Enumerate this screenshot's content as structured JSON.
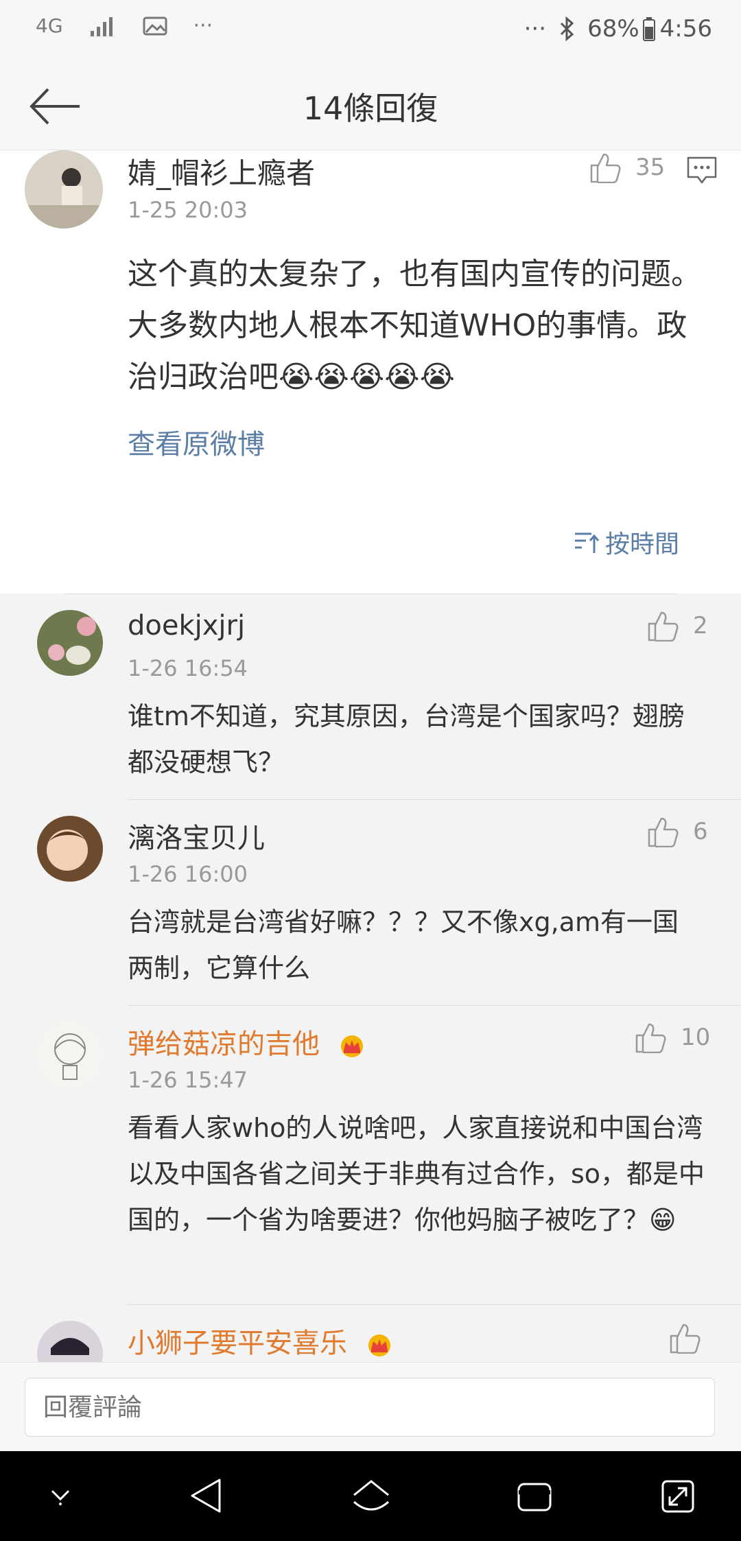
{
  "status_bar": {
    "network": "4G",
    "more_left": "···",
    "more_right": "···",
    "battery": "68%",
    "time": "4:56"
  },
  "header": {
    "title": "14條回復"
  },
  "main_comment": {
    "name": "婧_帽衫上瘾者",
    "time": "1-25 20:03",
    "likes": "35",
    "text": "这个真的太复杂了，也有国内宣传的问题。大多数内地人根本不知道WHO的事情。政治归政治吧😭😭😭😭😭",
    "view_original": "查看原微博"
  },
  "sort_label": "按時間",
  "replies": [
    {
      "name": "doekjxjrj",
      "time": "1-26 16:54",
      "likes": "2",
      "text": "谁tm不知道，究其原因，台湾是个国家吗？翅膀都没硬想飞？"
    },
    {
      "name": "漓洛宝贝儿",
      "time": "1-26 16:00",
      "likes": "6",
      "text": "台湾就是台湾省好嘛？？？又不像xg,am有一国两制，它算什么"
    },
    {
      "name": "弹给菇凉的吉他",
      "time": "1-26 15:47",
      "likes": "10",
      "text": "看看人家who的人说啥吧，人家直接说和中国台湾以及中国各省之间关于非典有过合作，so，都是中国的，一个省为啥要进？你他妈脑子被吃了？😁"
    },
    {
      "name": "小狮子要平安喜乐",
      "time": "",
      "likes": "",
      "text": ""
    }
  ],
  "input": {
    "placeholder": "回覆評論"
  },
  "colors": {
    "link": "#5b7ea7",
    "vip_name": "#e07a2e",
    "reply_bg": "#f3f3f3"
  }
}
